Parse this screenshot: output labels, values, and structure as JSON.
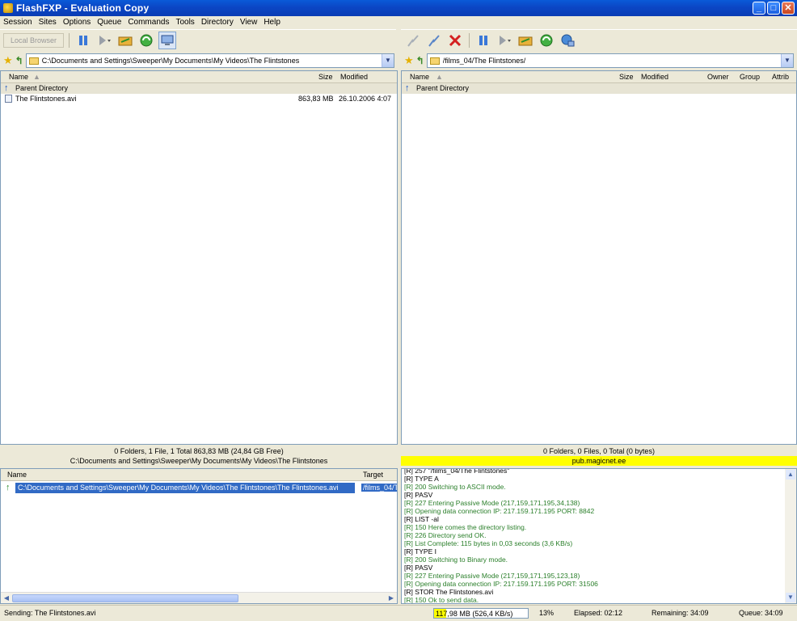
{
  "window": {
    "title": "FlashFXP - Evaluation Copy"
  },
  "menu": [
    "Session",
    "Sites",
    "Options",
    "Queue",
    "Commands",
    "Tools",
    "Directory",
    "View",
    "Help"
  ],
  "left_toolbar": {
    "local_browser_label": "Local Browser"
  },
  "left_path": "C:\\Documents and Settings\\Sweeper\\My Documents\\My Videos\\The Flintstones",
  "right_path": "/films_04/The Flintstones/",
  "left_list": {
    "headers": {
      "name": "Name",
      "size": "Size",
      "modified": "Modified"
    },
    "parent": "Parent Directory",
    "files": [
      {
        "name": "The Flintstones.avi",
        "size": "863,83 MB",
        "modified": "26.10.2006 4:07"
      }
    ]
  },
  "right_list": {
    "headers": {
      "name": "Name",
      "size": "Size",
      "modified": "Modified",
      "owner": "Owner",
      "group": "Group",
      "attrib": "Attrib"
    },
    "parent": "Parent Directory"
  },
  "left_status": {
    "summary": "0 Folders, 1 File, 1 Total 863,83 MB (24,84 GB Free)",
    "path": "C:\\Documents and Settings\\Sweeper\\My Documents\\My Videos\\The Flintstones"
  },
  "right_status": {
    "summary": "0 Folders, 0 Files, 0 Total (0 bytes)",
    "host": "pub.magicnet.ee"
  },
  "queue": {
    "headers": {
      "name": "Name",
      "target": "Target"
    },
    "items": [
      {
        "source": "C:\\Documents and Settings\\Sweeper\\My Documents\\My Videos\\The Flintstones\\The Flintstones.avi",
        "target": "/films_04/Th"
      }
    ]
  },
  "log": [
    {
      "text": "[R] 257 \"/films_04/The Flintstones\"",
      "color": "black"
    },
    {
      "text": "[R] TYPE A",
      "color": "black"
    },
    {
      "text": "[R] 200 Switching to ASCII mode.",
      "color": "green"
    },
    {
      "text": "[R] PASV",
      "color": "black"
    },
    {
      "text": "[R] 227 Entering Passive Mode (217,159,171,195,34,138)",
      "color": "green"
    },
    {
      "text": "[R] Opening data connection IP: 217.159.171.195 PORT: 8842",
      "color": "green"
    },
    {
      "text": "[R] LIST -al",
      "color": "black"
    },
    {
      "text": "[R] 150 Here comes the directory listing.",
      "color": "green"
    },
    {
      "text": "[R] 226 Directory send OK.",
      "color": "green"
    },
    {
      "text": "[R] List Complete: 115 bytes in 0,03 seconds (3,6 KB/s)",
      "color": "green"
    },
    {
      "text": "[R] TYPE I",
      "color": "black"
    },
    {
      "text": "[R] 200 Switching to Binary mode.",
      "color": "green"
    },
    {
      "text": "[R] PASV",
      "color": "black"
    },
    {
      "text": "[R] 227 Entering Passive Mode (217,159,171,195,123,18)",
      "color": "green"
    },
    {
      "text": "[R] Opening data connection IP: 217.159.171.195 PORT: 31506",
      "color": "green"
    },
    {
      "text": "[R] STOR The Flintstones.avi",
      "color": "black"
    },
    {
      "text": "[R] 150 Ok to send data.",
      "color": "green"
    }
  ],
  "statusbar": {
    "sending": "Sending: The Flintstones.avi",
    "transferred": "117,98 MB (526,4 KB/s)",
    "percent": "13%",
    "progress_fraction": 0.13,
    "elapsed": "Elapsed: 02:12",
    "remaining": "Remaining: 34:09",
    "queue": "Queue: 34:09"
  },
  "colors": {
    "title": "#0b46c5",
    "selection": "#316ac5",
    "log_green": "#2a7f2a",
    "highlight_yellow": "#ffff00"
  }
}
